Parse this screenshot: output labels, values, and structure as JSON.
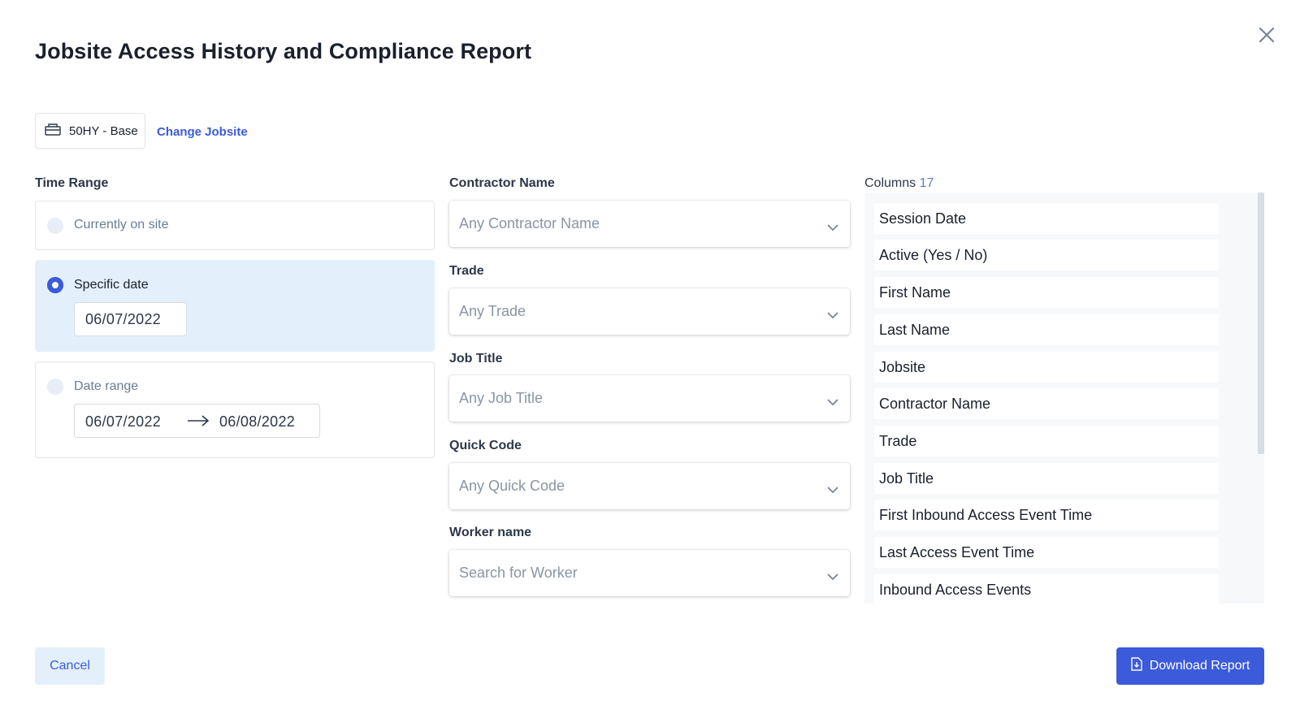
{
  "dialog": {
    "title": "Jobsite Access History and Compliance Report",
    "close_icon": "close-icon"
  },
  "jobsite": {
    "name": "50HY - Base",
    "icon": "building-icon",
    "change_label": "Change Jobsite"
  },
  "time_range": {
    "label": "Time Range",
    "options": [
      {
        "label": "Currently on site",
        "selected": false
      },
      {
        "label": "Specific date",
        "selected": true,
        "date": "06/07/2022"
      },
      {
        "label": "Date range",
        "selected": false,
        "start": "06/07/2022",
        "end": "06/08/2022"
      }
    ]
  },
  "filters": [
    {
      "label": "Contractor Name",
      "placeholder": "Any Contractor Name"
    },
    {
      "label": "Trade",
      "placeholder": "Any Trade"
    },
    {
      "label": "Job Title",
      "placeholder": "Any Job Title"
    },
    {
      "label": "Quick Code",
      "placeholder": "Any Quick Code"
    },
    {
      "label": "Worker name",
      "placeholder": "Search for Worker"
    }
  ],
  "columns": {
    "label": "Columns",
    "count": "17",
    "items": [
      "Session Date",
      "Active (Yes / No)",
      "First Name",
      "Last Name",
      "Jobsite",
      "Contractor Name",
      "Trade",
      "Job Title",
      "First Inbound Access Event Time",
      "Last Access Event Time",
      "Inbound Access Events"
    ]
  },
  "footer": {
    "cancel_label": "Cancel",
    "download_label": "Download Report"
  },
  "colors": {
    "accent": "#3b5bdb",
    "selected_bg": "#e3f0fc"
  }
}
